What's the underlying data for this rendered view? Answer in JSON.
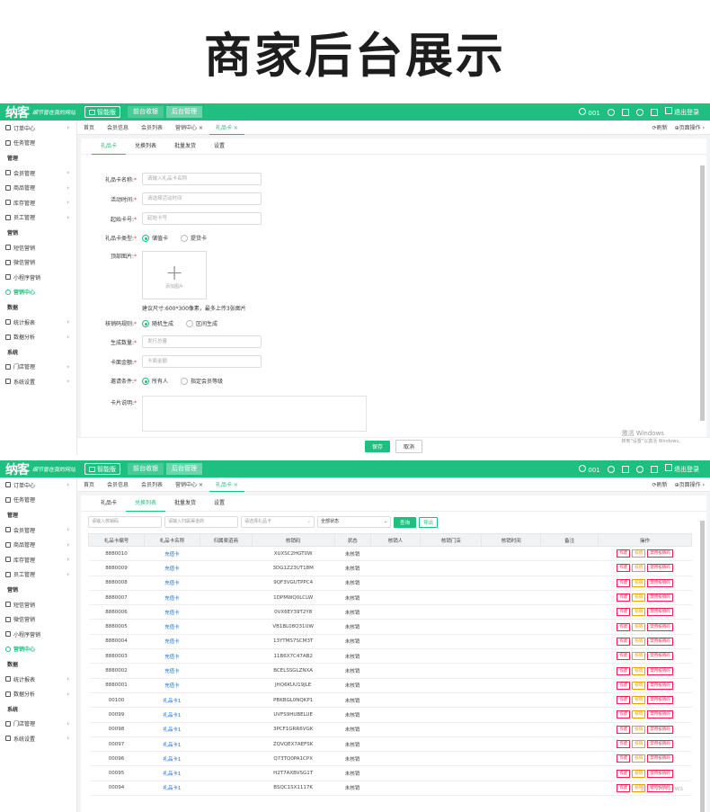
{
  "headline": "商家后台展示",
  "topbar": {
    "logo": "纳客",
    "slogan": "细节管在我的网站",
    "store_label": "智能版",
    "nav": [
      "前台收银",
      "后台管理"
    ],
    "user": "001",
    "logout": "退出登录"
  },
  "sidebar": {
    "items": [
      {
        "label": "订单中心",
        "type": "item",
        "arrow": "›"
      },
      {
        "label": "任务管理",
        "type": "item",
        "arrow": ""
      },
      {
        "label": "管理",
        "type": "group",
        "arrow": ""
      },
      {
        "label": "会员管理",
        "type": "item",
        "arrow": "›"
      },
      {
        "label": "商品管理",
        "type": "item",
        "arrow": "›"
      },
      {
        "label": "库存管理",
        "type": "item",
        "arrow": "›"
      },
      {
        "label": "员工管理",
        "type": "item",
        "arrow": "›"
      },
      {
        "label": "营销",
        "type": "group",
        "arrow": ""
      },
      {
        "label": "短信营销",
        "type": "item",
        "arrow": ""
      },
      {
        "label": "微信营销",
        "type": "item",
        "arrow": ""
      },
      {
        "label": "小程序营销",
        "type": "item",
        "arrow": ""
      },
      {
        "label": "营销中心",
        "type": "active",
        "arrow": ""
      },
      {
        "label": "数据",
        "type": "group",
        "arrow": ""
      },
      {
        "label": "统计报表",
        "type": "item",
        "arrow": "›"
      },
      {
        "label": "数据分析",
        "type": "item",
        "arrow": "›"
      },
      {
        "label": "系统",
        "type": "group",
        "arrow": ""
      },
      {
        "label": "门店管理",
        "type": "item",
        "arrow": "›"
      },
      {
        "label": "系统设置",
        "type": "item",
        "arrow": "›"
      }
    ]
  },
  "tabs": {
    "items": [
      "首页",
      "会员信息",
      "会员列表",
      "营销中心 ×",
      "礼品卡 ×"
    ],
    "refresh": "刷新",
    "page_ops": "页面操作"
  },
  "subtabs": [
    "礼品卡",
    "兑换列表",
    "批量发货",
    "设置"
  ],
  "form": {
    "name_label": "礼品卡名称:",
    "name_ph": "请输入礼品卡名称",
    "time_label": "活动时间:",
    "time_ph": "请选择活动时间",
    "start_label": "起始卡号:",
    "start_ph": "起始卡号",
    "type_label": "礼品卡类型:",
    "type_opt1": "储值卡",
    "type_opt2": "提货卡",
    "img_label": "顶部图片:",
    "img_add": "添加图片",
    "img_tip": "建议尺寸:600*300像素，最多上传3张图片",
    "rule_label": "核销码规则:",
    "rule_opt1": "随机生成",
    "rule_opt2": "区间生成",
    "qty_label": "生成数量:",
    "qty_ph": "发行总量",
    "amt_label": "卡面金额:",
    "amt_ph": "卡面金额",
    "cond_label": "邀请条件:",
    "cond_opt1": "所有人",
    "cond_opt2": "指定会员等级",
    "desc_label": "卡片说明:",
    "save": "保存",
    "cancel": "取消"
  },
  "watermark": {
    "title": "激活 Windows",
    "sub": "转到\"设置\"以激活 Windows。",
    "title2": "激活 Windows"
  },
  "filters": {
    "code_ph": "请输入核销码",
    "channel_ph": "请输入归属渠道商",
    "card_ph": "请选择礼品卡",
    "status": "全部状态",
    "query": "查询",
    "export": "导出"
  },
  "table": {
    "headers": [
      "礼品卡编号",
      "礼品卡名称",
      "归属渠道商",
      "核销码",
      "状态",
      "核销人",
      "核销门店",
      "核销时间",
      "备注",
      "操作"
    ],
    "ops": [
      "作废",
      "核销",
      "禁用核销码"
    ],
    "rows": [
      [
        "8880010",
        "充值卡",
        "",
        "XUXSC2HGT0W",
        "未核销"
      ],
      [
        "8880009",
        "充值卡",
        "",
        "3DG1Z23UT18M",
        "未核销"
      ],
      [
        "8880008",
        "充值卡",
        "",
        "9QF3VGUTPPC4",
        "未核销"
      ],
      [
        "8880007",
        "充值卡",
        "",
        "1DPMWQ0LCLW",
        "未核销"
      ],
      [
        "8880006",
        "充值卡",
        "",
        "0VX6EY39T2Y8",
        "未核销"
      ],
      [
        "8880005",
        "充值卡",
        "",
        "VB1BL08Q31UW",
        "未核销"
      ],
      [
        "8880004",
        "充值卡",
        "",
        "13YTMS7SCM3T",
        "未核销"
      ],
      [
        "8880003",
        "充值卡",
        "",
        "11B6X7C47AB2",
        "未核销"
      ],
      [
        "8880002",
        "充值卡",
        "",
        "BCELSSGLZNXA",
        "未核销"
      ],
      [
        "8880001",
        "充值卡",
        "",
        "JHQ6KUU19JLE",
        "未核销"
      ],
      [
        "00100",
        "礼品卡1",
        "",
        "PBKBGL0NQKP1",
        "未核销"
      ],
      [
        "00099",
        "礼品卡1",
        "",
        "UVFS9HUBELUE",
        "未核销"
      ],
      [
        "00098",
        "礼品卡1",
        "",
        "3PCF1GRR6VGK",
        "未核销"
      ],
      [
        "00097",
        "礼品卡1",
        "",
        "ZQVQEX7AEFSK",
        "未核销"
      ],
      [
        "00096",
        "礼品卡1",
        "",
        "Q73TQ0PA1CPX",
        "未核销"
      ],
      [
        "00095",
        "礼品卡1",
        "",
        "H2T7AXBVSG1T",
        "未核销"
      ],
      [
        "00094",
        "礼品卡1",
        "",
        "BSQC1SX1117K",
        "未核销"
      ]
    ]
  },
  "colors": {
    "brand": "#1fbf7f",
    "link": "#1a6fd6",
    "danger": "#e22255",
    "warn": "#e9a200"
  }
}
